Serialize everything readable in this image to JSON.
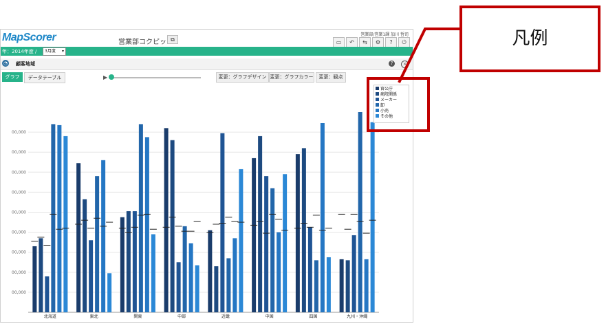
{
  "app": {
    "logo": "MapScorer",
    "title": "営業部コクピット",
    "title_button_icon": "⧉",
    "top_right": "営業部/営業1課 加川 哲司",
    "toolbar_icons": [
      "▭",
      "↶",
      "⇆",
      "⚙",
      "?",
      "⏻"
    ]
  },
  "filter": {
    "label": "年：2014年度 /",
    "month": "3月度",
    "arrow": "▾"
  },
  "panel": {
    "title": "顧客地域",
    "help": "?",
    "close": "×",
    "icon": "◔"
  },
  "tabs": {
    "graph": "グラフ",
    "table": "データテーブル"
  },
  "buttons": {
    "design": "変更：グラフデザイン",
    "color": "変更：グラフカラー",
    "view": "変更：観点"
  },
  "callout": {
    "label": "凡例"
  },
  "colors": {
    "accent": "#27b38a",
    "callout": "#c00000",
    "series": [
      "#1a3c6b",
      "#1d4a80",
      "#1f5494",
      "#2266aa",
      "#2577c4",
      "#2b88d6"
    ]
  },
  "chart_data": {
    "type": "bar",
    "categories": [
      "北海道",
      "東北",
      "関東",
      "中部",
      "近畿",
      "中国",
      "四国",
      "九州・沖縄"
    ],
    "series": [
      {
        "name": "官公庁",
        "values": [
          330,
          745,
          475,
          920,
          410,
          770,
          790,
          265
        ]
      },
      {
        "name": "病院関係",
        "values": [
          370,
          565,
          505,
          860,
          230,
          880,
          820,
          260
        ]
      },
      {
        "name": "メーカー",
        "values": [
          180,
          360,
          505,
          250,
          895,
          680,
          425,
          385
        ]
      },
      {
        "name": "卸",
        "values": [
          940,
          680,
          940,
          430,
          270,
          620,
          260,
          1000
        ]
      },
      {
        "name": "小売",
        "values": [
          935,
          760,
          875,
          345,
          370,
          400,
          945,
          265
        ]
      },
      {
        "name": "その他",
        "values": [
          880,
          195,
          390,
          235,
          715,
          690,
          275,
          950
        ]
      }
    ],
    "marker_values": [
      [
        355,
        440,
        420,
        425,
        400,
        435,
        420,
        490
      ],
      [
        375,
        460,
        400,
        475,
        440,
        455,
        445,
        415
      ],
      [
        335,
        420,
        425,
        430,
        445,
        395,
        425,
        490
      ],
      [
        490,
        470,
        485,
        405,
        475,
        490,
        485,
        455
      ],
      [
        415,
        430,
        490,
        405,
        455,
        465,
        410,
        395
      ],
      [
        420,
        450,
        415,
        455,
        450,
        410,
        420,
        460
      ]
    ],
    "ytick_labels": [
      "00,000",
      "00,000",
      "00,000",
      "00,000",
      "00,000",
      "00,000",
      "00,000",
      "00,000",
      "00,000"
    ],
    "ylim": [
      0,
      1000
    ],
    "legend": "right"
  }
}
